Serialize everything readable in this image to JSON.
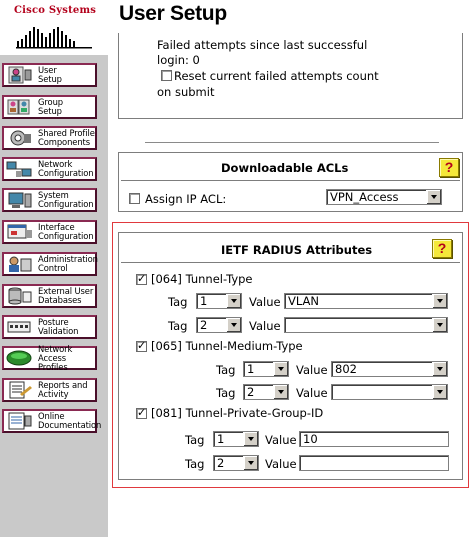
{
  "brand": {
    "name": "Cisco Systems"
  },
  "header": {
    "title": "User Setup"
  },
  "nav": {
    "items": [
      {
        "label": "User\nSetup",
        "icon": "user-setup-icon"
      },
      {
        "label": "Group\nSetup",
        "icon": "group-setup-icon"
      },
      {
        "label": "Shared Profile\nComponents",
        "icon": "shared-profile-icon"
      },
      {
        "label": "Network\nConfiguration",
        "icon": "network-config-icon"
      },
      {
        "label": "System\nConfiguration",
        "icon": "system-config-icon"
      },
      {
        "label": "Interface\nConfiguration",
        "icon": "interface-config-icon"
      },
      {
        "label": "Administration\nControl",
        "icon": "admin-control-icon"
      },
      {
        "label": "External User\nDatabases",
        "icon": "external-db-icon"
      },
      {
        "label": "Posture\nValidation",
        "icon": "posture-validation-icon"
      },
      {
        "label": "Network Access\nProfiles",
        "icon": "network-access-profiles-icon"
      },
      {
        "label": "Reports and\nActivity",
        "icon": "reports-icon"
      },
      {
        "label": "Online\nDocumentation",
        "icon": "online-docs-icon"
      }
    ]
  },
  "failed_attempts": {
    "line1": "Failed attempts since last successful",
    "line2": "login: 0",
    "reset_label_line1": "Reset current failed attempts count",
    "reset_label_line2": "on submit",
    "reset_checked": false
  },
  "downloadable_acls": {
    "title": "Downloadable ACLs",
    "help": "?",
    "assign_label": "Assign IP ACL:",
    "assign_checked": false,
    "acl_value": "VPN_Access"
  },
  "ietf": {
    "title": "IETF RADIUS Attributes",
    "help": "?",
    "tunnel_type": {
      "label": "[064] Tunnel-Type",
      "checked": true,
      "rows": [
        {
          "tag_label": "Tag",
          "tag": "1",
          "value_label": "Value",
          "value": "VLAN"
        },
        {
          "tag_label": "Tag",
          "tag": "2",
          "value_label": "Value",
          "value": ""
        }
      ]
    },
    "tunnel_medium": {
      "label": "[065] Tunnel-Medium-Type",
      "checked": true,
      "rows": [
        {
          "tag_label": "Tag",
          "tag": "1",
          "value_label": "Value",
          "value": "802"
        },
        {
          "tag_label": "Tag",
          "tag": "2",
          "value_label": "Value",
          "value": ""
        }
      ]
    },
    "private_group": {
      "label": "[081] Tunnel-Private-Group-ID",
      "checked": true,
      "rows": [
        {
          "tag_label": "Tag",
          "tag": "1",
          "value_label": "Value",
          "value": "10"
        },
        {
          "tag_label": "Tag",
          "tag": "2",
          "value_label": "Value",
          "value": ""
        }
      ]
    }
  },
  "colors": {
    "highlight_border": "#e0393e",
    "nav_background": "#c9c9c9",
    "nav_border": "#8a2a52",
    "help_yellow": "#f5e83a",
    "brand_red": "#b3001b"
  }
}
